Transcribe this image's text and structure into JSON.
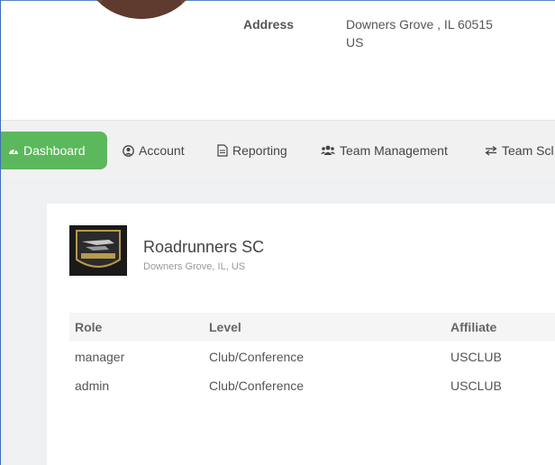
{
  "address": {
    "label": "Address",
    "line1": "Downers Grove , IL 60515",
    "line2": "US"
  },
  "nav": {
    "dashboard": "Dashboard",
    "account": "Account",
    "reporting": "Reporting",
    "team_management": "Team Management",
    "team_schedule": "Team Scl"
  },
  "club": {
    "name": "Roadrunners SC",
    "location": "Downers Grove, IL, US"
  },
  "table": {
    "headers": [
      "Role",
      "Level",
      "Affiliate"
    ],
    "rows": [
      [
        "manager",
        "Club/Conference",
        "USCLUB"
      ],
      [
        "admin",
        "Club/Conference",
        "USCLUB"
      ]
    ]
  },
  "colors": {
    "dashboard_active": "#5cb85c",
    "nav_background": "#f1f1f1",
    "page_background": "#eef0f2"
  }
}
